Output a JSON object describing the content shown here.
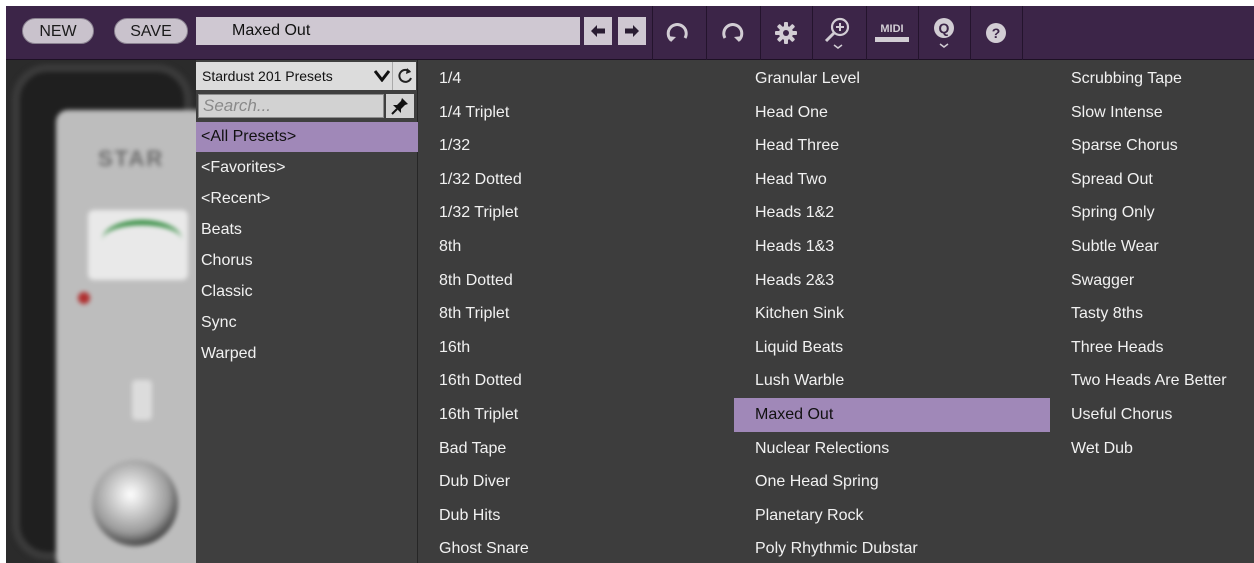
{
  "toolbar": {
    "new_label": "NEW",
    "save_label": "SAVE",
    "current_preset": "Maxed Out",
    "prev_glyph": "←",
    "next_glyph": "→",
    "icons": [
      "undo-icon",
      "redo-icon",
      "gear-icon",
      "zoom-icon",
      "midi-icon",
      "q-icon",
      "help-icon"
    ],
    "midi_label": "MIDI",
    "q_label": "Q",
    "help_label": "?"
  },
  "browser": {
    "bank_name": "Stardust 201 Presets",
    "search_placeholder": "Search...",
    "categories": [
      "<All Presets>",
      "<Favorites>",
      "<Recent>",
      "Beats",
      "Chorus",
      "Classic",
      "Sync",
      "Warped"
    ],
    "selected_category": "<All Presets>",
    "preset_columns": [
      [
        "1/4",
        "1/4 Triplet",
        "1/32",
        "1/32 Dotted",
        "1/32 Triplet",
        "8th",
        "8th Dotted",
        "8th Triplet",
        "16th",
        "16th Dotted",
        "16th Triplet",
        "Bad Tape",
        "Dub Diver",
        "Dub Hits",
        "Ghost Snare"
      ],
      [
        "Granular Level",
        "Head One",
        "Head Three",
        "Head Two",
        "Heads 1&2",
        "Heads 1&3",
        "Heads 2&3",
        "Kitchen Sink",
        "Liquid Beats",
        "Lush Warble",
        "Maxed Out",
        "Nuclear Relections",
        "One Head Spring",
        "Planetary Rock",
        "Poly Rhythmic Dubstar"
      ],
      [
        "Scrubbing Tape",
        "Slow Intense",
        "Sparse Chorus",
        "Spread Out",
        "Spring Only",
        "Subtle Wear",
        "Swagger",
        "Tasty 8ths",
        "Three Heads",
        "Two Heads Are Better",
        "Useful Chorus",
        "Wet Dub"
      ]
    ],
    "selected_preset": "Maxed Out"
  },
  "plugin_bg": {
    "brand_text": "STAR"
  },
  "colors": {
    "toolbar_bg": "#3c2548",
    "highlight": "#a088b8",
    "list_bg": "#3d3d3d",
    "text": "#f1f1f1"
  }
}
